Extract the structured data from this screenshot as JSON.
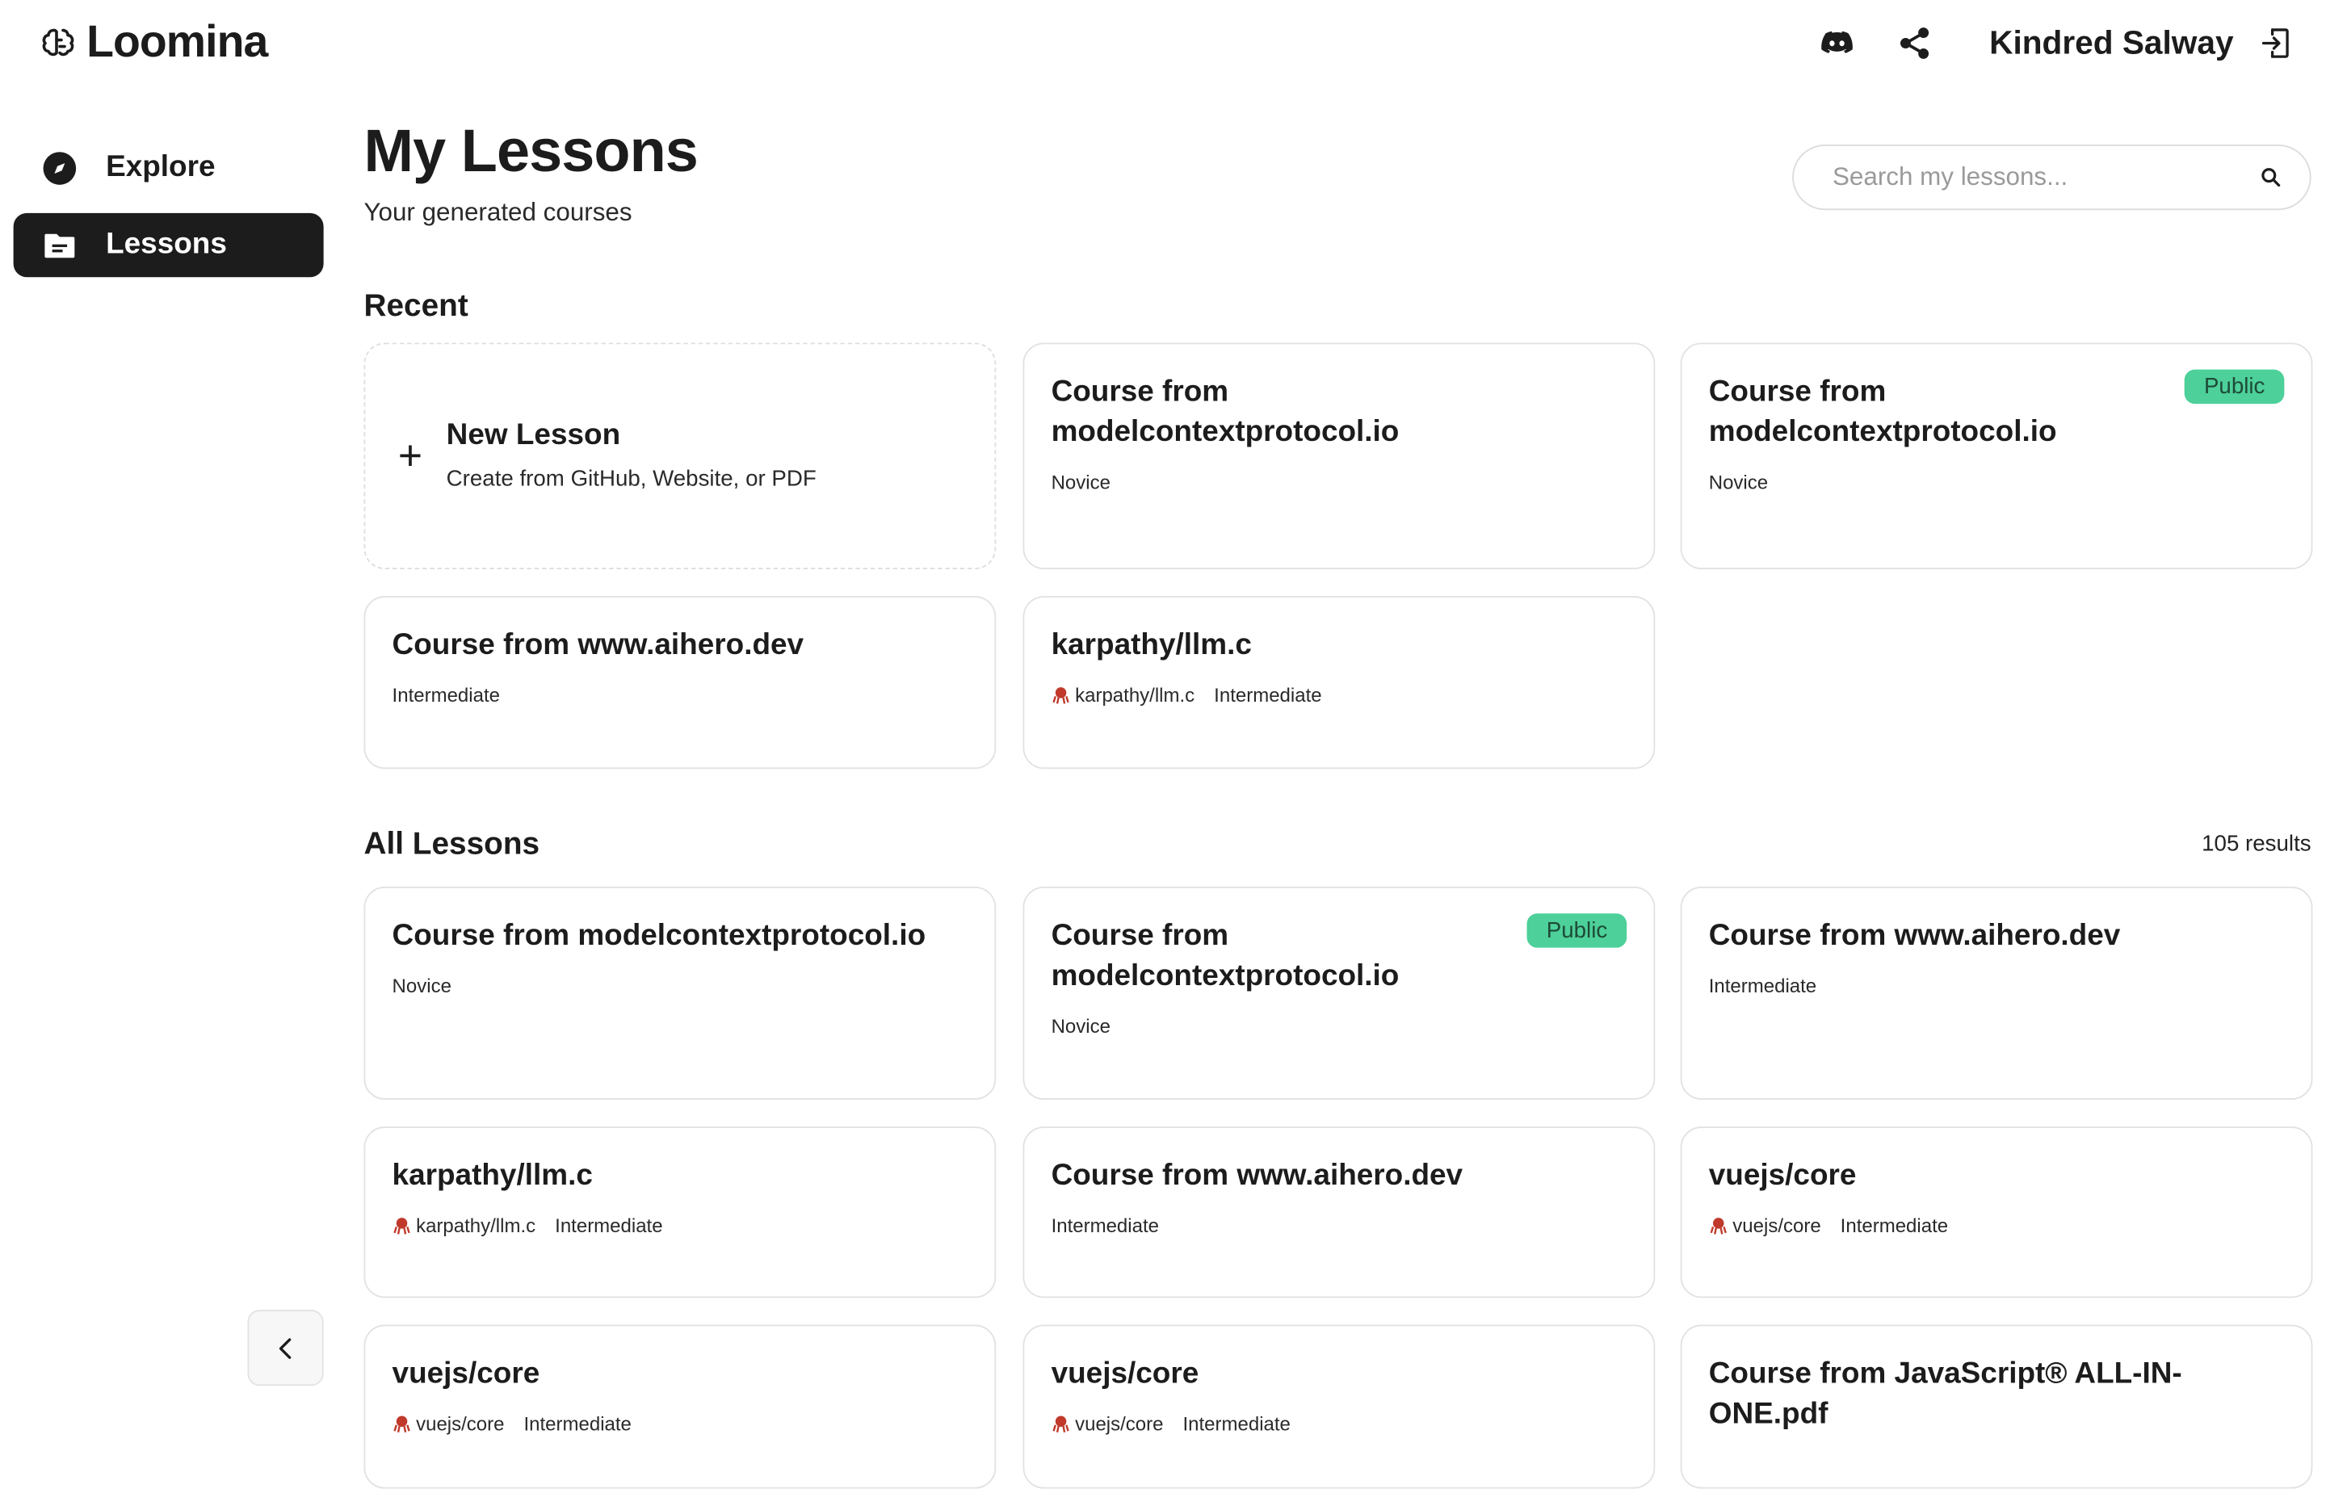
{
  "app": {
    "name": "Loomina"
  },
  "header": {
    "user_name": "Kindred Salway"
  },
  "sidebar": {
    "items": [
      {
        "label": "Explore"
      },
      {
        "label": "Lessons"
      }
    ]
  },
  "page": {
    "title": "My Lessons",
    "subtitle": "Your generated courses",
    "search_placeholder": "Search my lessons..."
  },
  "recent": {
    "title": "Recent",
    "new_lesson": {
      "title": "New Lesson",
      "subtitle": "Create from GitHub, Website, or PDF"
    },
    "cards": [
      {
        "title": "Course from modelcontextprotocol.io",
        "level": "Novice"
      },
      {
        "title": "Course from modelcontextprotocol.io",
        "level": "Novice",
        "badge": "Public"
      },
      {
        "title": "Course from www.aihero.dev",
        "level": "Intermediate"
      },
      {
        "title": "karpathy/llm.c",
        "repo": "karpathy/llm.c",
        "level": "Intermediate"
      }
    ]
  },
  "all": {
    "title": "All Lessons",
    "results": "105 results",
    "cards": [
      {
        "title": "Course from modelcontextprotocol.io",
        "level": "Novice"
      },
      {
        "title": "Course from modelcontextprotocol.io",
        "level": "Novice",
        "badge": "Public"
      },
      {
        "title": "Course from www.aihero.dev",
        "level": "Intermediate"
      },
      {
        "title": "karpathy/llm.c",
        "repo": "karpathy/llm.c",
        "level": "Intermediate"
      },
      {
        "title": "Course from www.aihero.dev",
        "level": "Intermediate"
      },
      {
        "title": "vuejs/core",
        "repo": "vuejs/core",
        "level": "Intermediate"
      },
      {
        "title": "vuejs/core",
        "repo": "vuejs/core",
        "level": "Intermediate"
      },
      {
        "title": "vuejs/core",
        "repo": "vuejs/core",
        "level": "Intermediate"
      },
      {
        "title": "Course from JavaScript® ALL-IN-ONE.pdf"
      }
    ]
  },
  "colors": {
    "accent": "#1c1c1c",
    "public_badge": "#4dd09a"
  },
  "icons": [
    "brain-logo-icon",
    "discord-icon",
    "share-icon",
    "logout-icon",
    "compass-icon",
    "folder-icon",
    "search-icon",
    "plus-icon",
    "github-icon",
    "chevron-left-icon"
  ]
}
